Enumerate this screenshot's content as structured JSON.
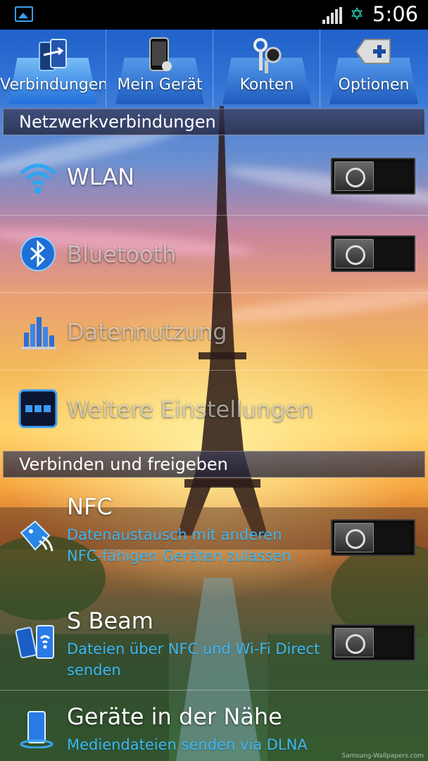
{
  "status_bar": {
    "time": "5:06",
    "icons": [
      "image-notification-icon",
      "signal-icon",
      "battery-icon"
    ]
  },
  "tabs": [
    {
      "label": "Verbindungen",
      "icon": "connections-icon",
      "active": true
    },
    {
      "label": "Mein Gerät",
      "icon": "phone-device-icon",
      "active": false
    },
    {
      "label": "Konten",
      "icon": "keys-icon",
      "active": false
    },
    {
      "label": "Optionen",
      "icon": "options-plus-icon",
      "active": false
    }
  ],
  "sections": {
    "network": "Netzwerkverbindungen",
    "connect_share": "Verbinden und freigeben"
  },
  "items": {
    "wlan": {
      "title": "WLAN",
      "toggle": "off"
    },
    "bluetooth": {
      "title": "Bluetooth",
      "toggle": "off"
    },
    "data_usage": {
      "title": "Datennutzung"
    },
    "more_settings": {
      "title": "Weitere Einstellungen"
    },
    "nfc": {
      "title": "NFC",
      "desc": "Datenaustausch mit anderen NFC-fähigen Geräten zulassen",
      "toggle": "off"
    },
    "s_beam": {
      "title": "S Beam",
      "desc": "Dateien über NFC und Wi-Fi Direct senden",
      "toggle": "off"
    },
    "nearby": {
      "title": "Geräte in der Nähe",
      "desc": "Mediendateien senden via DLNA"
    }
  },
  "watermark": "Samsung-Wallpapers.com",
  "colors": {
    "accent_blue": "#3db7f5",
    "status_bar": "#000000",
    "battery": "#2fd3c0"
  }
}
